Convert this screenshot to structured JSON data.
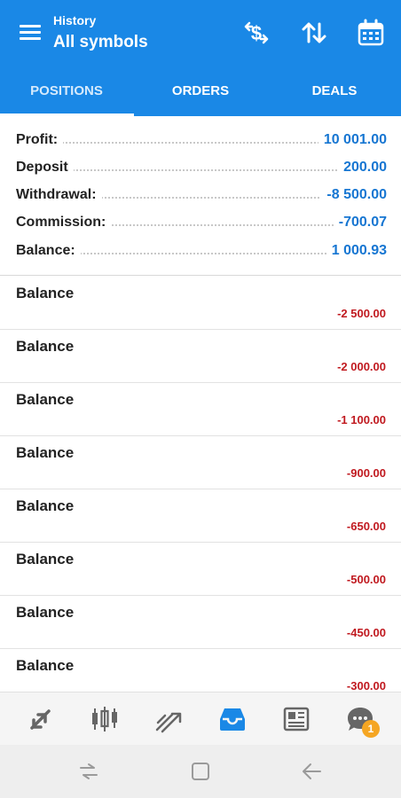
{
  "header": {
    "subtitle": "History",
    "title": "All symbols",
    "icons": [
      "currency-exchange-icon",
      "sort-arrows-icon",
      "calendar-icon"
    ]
  },
  "tabs": [
    {
      "label": "POSITIONS",
      "active": true
    },
    {
      "label": "ORDERS",
      "active": false
    },
    {
      "label": "DEALS",
      "active": false
    }
  ],
  "summary": {
    "rows": [
      {
        "label": "Profit:",
        "value": "10 001.00"
      },
      {
        "label": "Deposit",
        "value": "200.00"
      },
      {
        "label": "Withdrawal:",
        "value": "-8 500.00"
      },
      {
        "label": "Commission:",
        "value": "-700.07"
      },
      {
        "label": "Balance:",
        "value": "1 000.93"
      }
    ]
  },
  "deals": [
    {
      "title": "Balance",
      "amount": "-2 500.00"
    },
    {
      "title": "Balance",
      "amount": "-2 000.00"
    },
    {
      "title": "Balance",
      "amount": "-1 100.00"
    },
    {
      "title": "Balance",
      "amount": "-900.00"
    },
    {
      "title": "Balance",
      "amount": "-650.00"
    },
    {
      "title": "Balance",
      "amount": "-500.00"
    },
    {
      "title": "Balance",
      "amount": "-450.00"
    },
    {
      "title": "Balance",
      "amount": "-300.00"
    }
  ],
  "bottom_nav": {
    "items": [
      "quotes-icon",
      "charts-icon",
      "trade-icon",
      "history-icon",
      "news-icon",
      "messages-icon"
    ],
    "active": "history-icon",
    "messages_badge": "1"
  },
  "colors": {
    "primary": "#1a88e6",
    "value_blue": "#1676d2",
    "negative_red": "#c0191f",
    "badge": "#f5a623"
  }
}
